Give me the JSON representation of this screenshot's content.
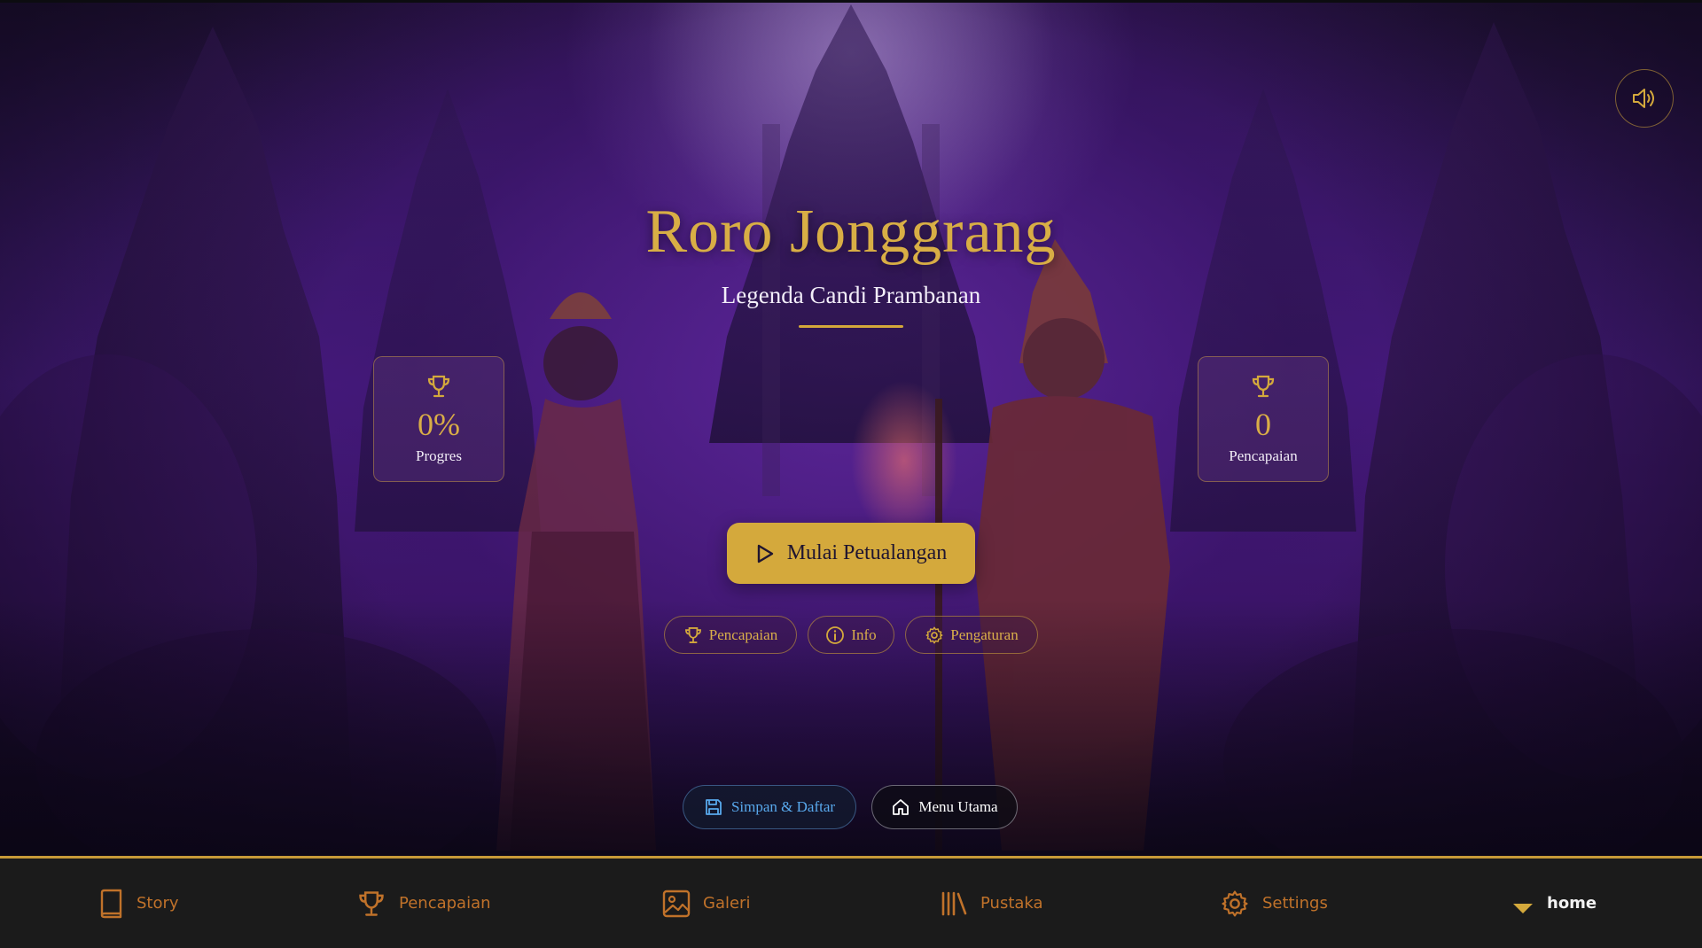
{
  "hero": {
    "title": "Roro Jonggrang",
    "subtitle": "Legenda Candi Prambanan",
    "sound_icon": "volume-icon"
  },
  "stats": {
    "progress": {
      "value": "0%",
      "label": "Progres",
      "icon": "trophy-icon"
    },
    "achievements": {
      "value": "0",
      "label": "Pencapaian",
      "icon": "trophy-icon"
    }
  },
  "actions": {
    "start_label": "Mulai Petualangan",
    "start_icon": "play-icon",
    "pills": [
      {
        "label": "Pencapaian",
        "icon": "trophy-icon"
      },
      {
        "label": "Info",
        "icon": "info-icon"
      },
      {
        "label": "Pengaturan",
        "icon": "gear-icon"
      }
    ],
    "save_label": "Simpan & Daftar",
    "save_icon": "save-icon",
    "menu_label": "Menu Utama",
    "menu_icon": "home-icon"
  },
  "bottom_nav": {
    "items": [
      {
        "label": "Story",
        "icon": "book-icon"
      },
      {
        "label": "Pencapaian",
        "icon": "trophy-icon"
      },
      {
        "label": "Galeri",
        "icon": "image-icon"
      },
      {
        "label": "Pustaka",
        "icon": "library-icon"
      },
      {
        "label": "Settings",
        "icon": "gear-icon"
      }
    ],
    "current": {
      "label": "home",
      "icon": "caret-down-icon"
    }
  },
  "colors": {
    "gold": "#d4a93c",
    "nav_orange": "#c0722a",
    "save_blue": "#58a8ec",
    "nav_bg": "#1b1b1b",
    "hero_purple": "#4a1d84"
  }
}
